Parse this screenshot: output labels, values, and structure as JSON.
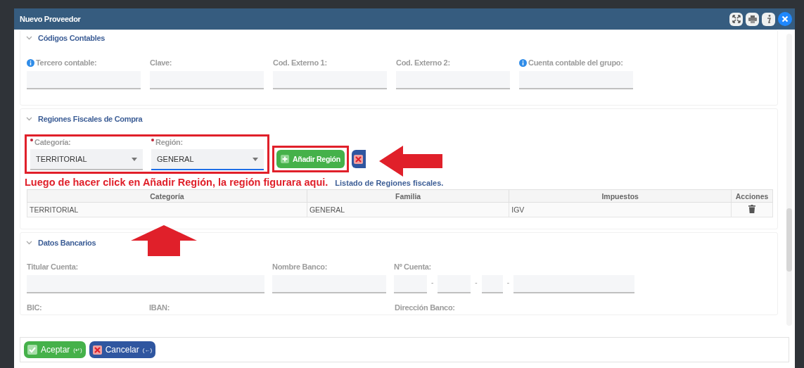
{
  "window": {
    "title": "Nuevo Proveedor",
    "buttons": [
      {
        "kind": "expand"
      },
      {
        "kind": "print"
      },
      {
        "kind": "info"
      },
      {
        "kind": "close"
      }
    ]
  },
  "codigos": {
    "title": "Códigos Contables",
    "expanded": true,
    "fields": [
      {
        "label": "Tercero contable:",
        "info": true
      },
      {
        "label": "Clave:",
        "info": false
      },
      {
        "label": "Cod. Externo 1:",
        "info": false
      },
      {
        "label": "Cod. Externo 2:",
        "info": false
      },
      {
        "label": "Cuenta contable del grupo:",
        "info": true
      }
    ]
  },
  "regiones": {
    "title": "Regiones Fiscales de Compra",
    "expanded": true,
    "selects": [
      {
        "label": "Categoría:",
        "value": "TERRITORIAL",
        "required": true,
        "focused": false
      },
      {
        "label": "Región:",
        "value": "GENERAL",
        "required": true,
        "focused": true
      }
    ],
    "add_button": "Añadir Región",
    "annotation": "Luego de hacer click en Añadir Región, la región figurara aqui.",
    "list_title": "Listado de Regiones fiscales.",
    "table": {
      "columns": [
        "Categoría",
        "Familia",
        "Impuestos",
        "Acciones"
      ],
      "rows": [
        {
          "cells": [
            "TERRITORIAL",
            "GENERAL",
            "IGV"
          ]
        }
      ]
    }
  },
  "bancarios": {
    "title": "Datos Bancarios",
    "expanded": true,
    "titular": "Titular Cuenta:",
    "banco": "Nombre Banco:",
    "cuenta": "Nº Cuenta:",
    "separator": "-",
    "labels2": [
      "BIC:",
      "IBAN:",
      "Dirección Banco:"
    ]
  },
  "footer": [
    {
      "kind": "accept",
      "label": "Aceptar",
      "shortcut": "(↵)"
    },
    {
      "kind": "cancel",
      "label": "Cancelar",
      "shortcut": "(←)"
    }
  ]
}
